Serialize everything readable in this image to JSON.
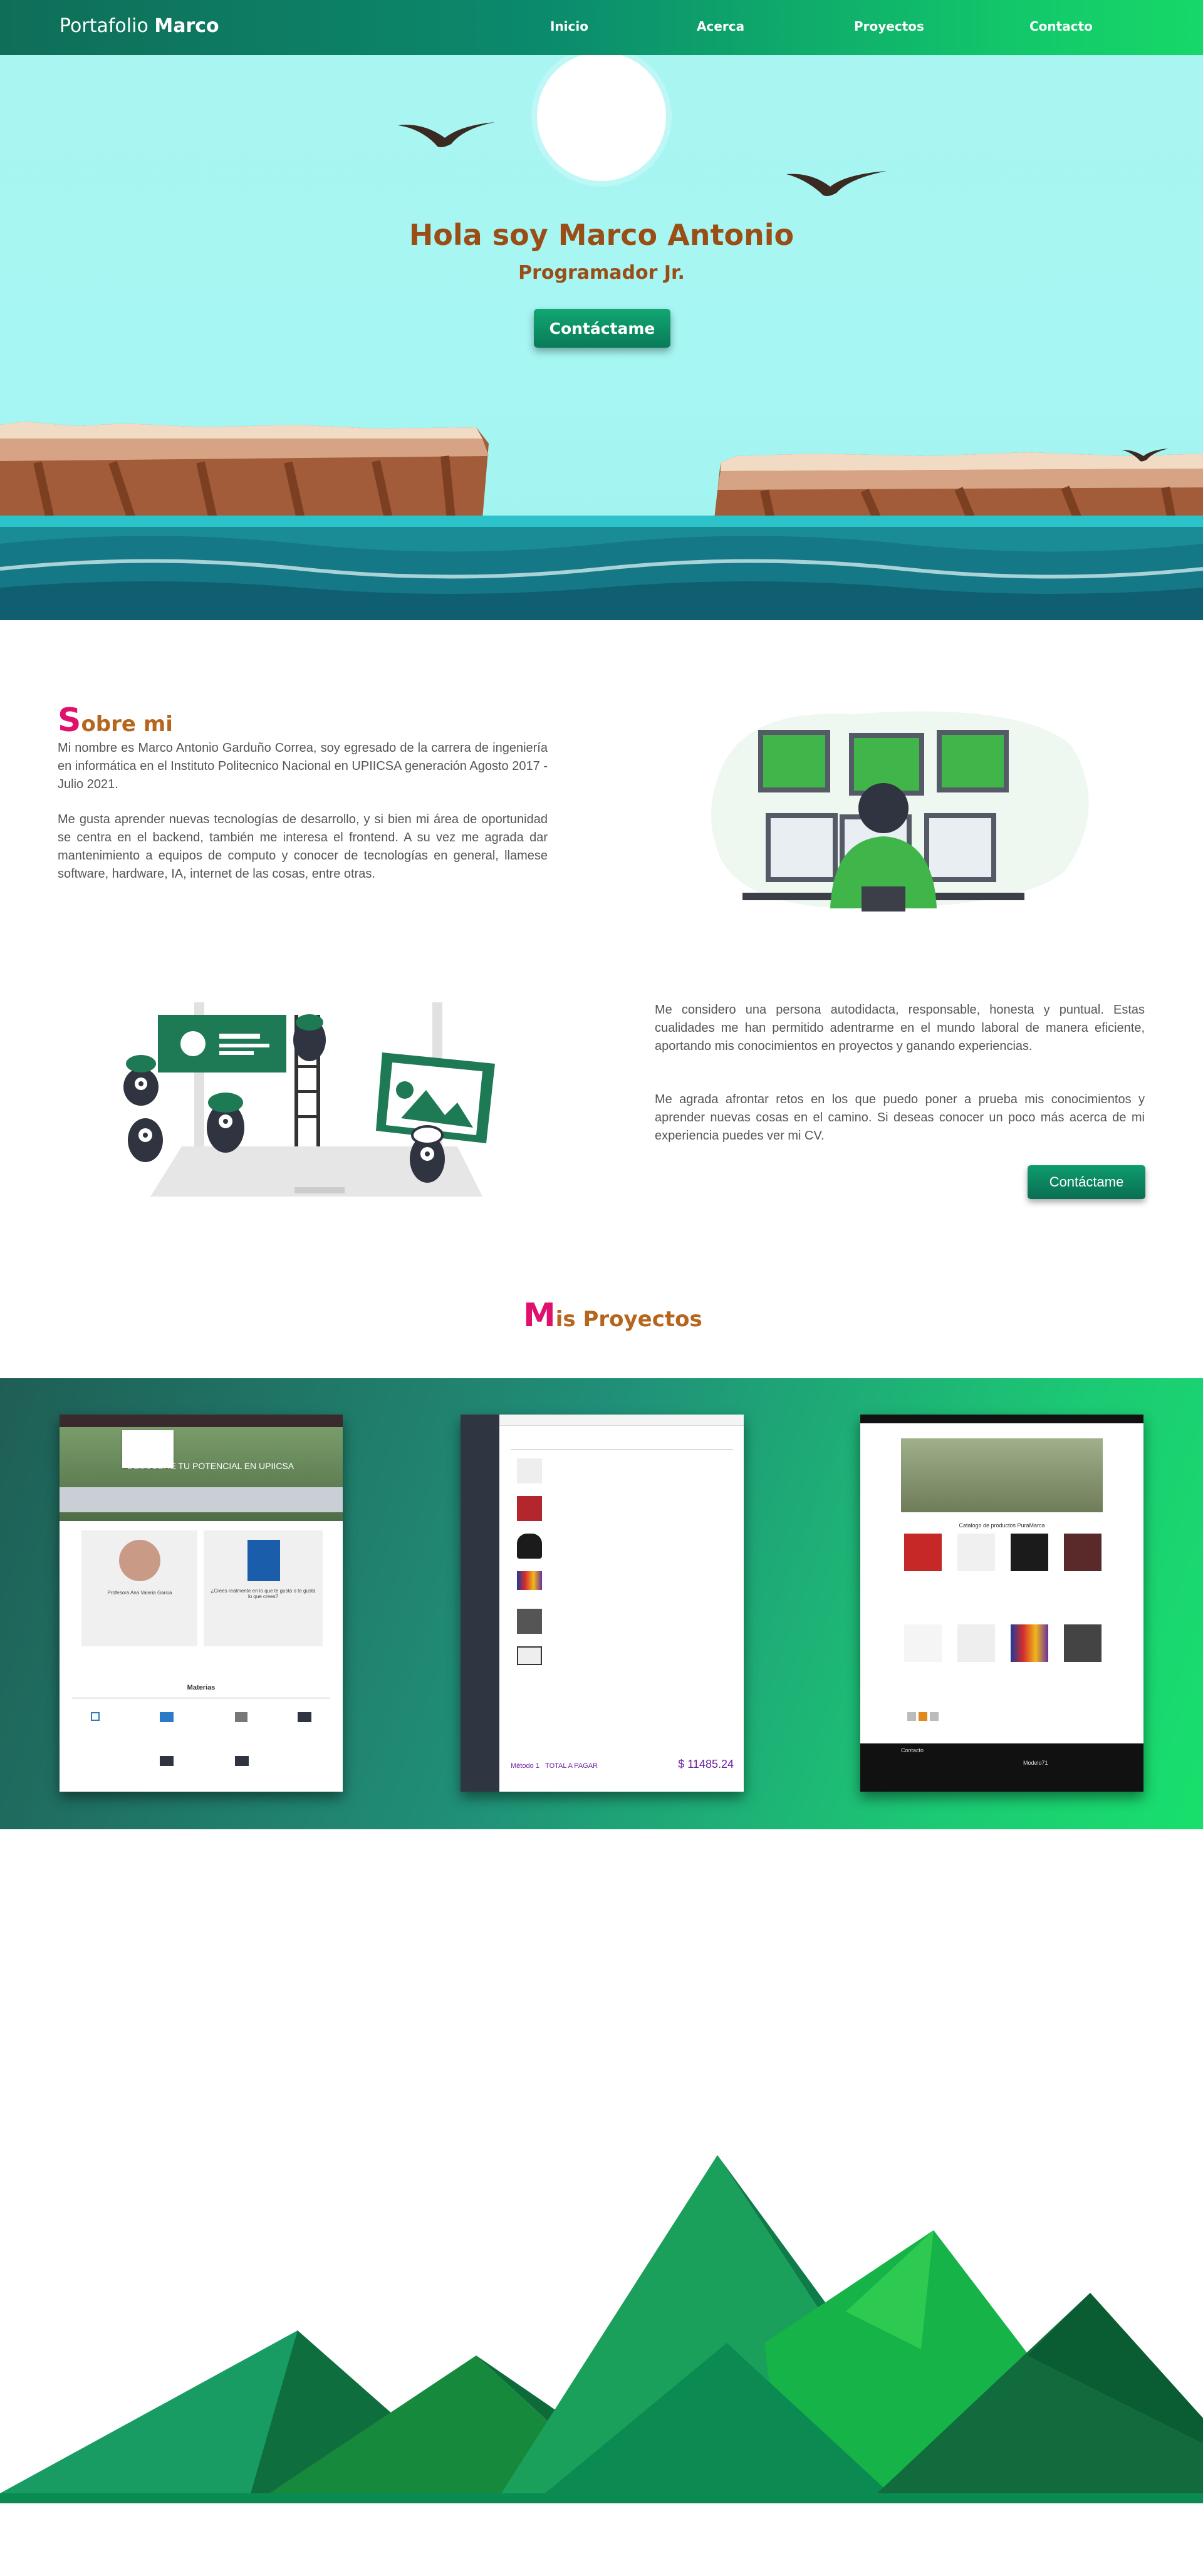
{
  "navbar": {
    "brand_prefix": "Portafolio",
    "brand_name": "Marco",
    "links": [
      "Inicio",
      "Acerca",
      "Proyectos",
      "Contacto"
    ]
  },
  "hero": {
    "title": "Hola soy Marco Antonio",
    "subtitle": "Programador Jr.",
    "button": "Contáctame"
  },
  "about": {
    "title_cap": "S",
    "title_rest": "obre mi",
    "paragraph1": "Mi nombre es Marco Antonio Garduño Correa, soy egresado de la carrera de ingeniería en informática en el Instituto Politecnico Nacional en UPIICSA generación Agosto 2017 - Julio 2021.",
    "paragraph2": "Me gusta aprender nuevas tecnologías de desarrollo, y si bien mi área de oportunidad se centra en el backend, también me interesa el frontend. A su vez me agrada dar mantenimiento a equipos de computo y conocer de tecnologías en general, llamese software, hardware, IA, internet de las cosas, entre otras.",
    "paragraph3": "Me considero una persona autodidacta, responsable, honesta y puntual. Estas cualidades me han permitido adentrarme en el mundo laboral de manera eficiente, aportando mis conocimientos en proyectos y ganando experiencias.",
    "paragraph4": "Me agrada afrontar retos en los que puedo poner a prueba mis conocimientos y aprender nuevas cosas en el camino. Si deseas conocer un poco más acerca de mi experiencia puedes ver mi CV.",
    "button": "Contáctame"
  },
  "projects": {
    "title_cap": "M",
    "title_rest": "is Proyectos",
    "card1": {
      "banner": "DESCUBRE TU POTENCIAL EN UPIICSA",
      "section": "Materias",
      "profile_name": "Profesora Ana Valeria Garcia",
      "book_caption": "¿Crees realmente en lo que te gusta o te gusta lo que crees?"
    },
    "card2": {
      "total_label": "TOTAL A PAGAR",
      "total_value": "$ 11485.24",
      "total_prefix": "Método 1"
    },
    "card3": {
      "catalog_title": "Catalogo de productos PuraMarca",
      "footer_label": "Contacto",
      "footer_brand": "Modelo71"
    }
  },
  "colors": {
    "accent": "#0b8a6c",
    "title_orange": "#b5651d",
    "title_pink": "#e0116d",
    "hero_text": "#9a4d14"
  }
}
